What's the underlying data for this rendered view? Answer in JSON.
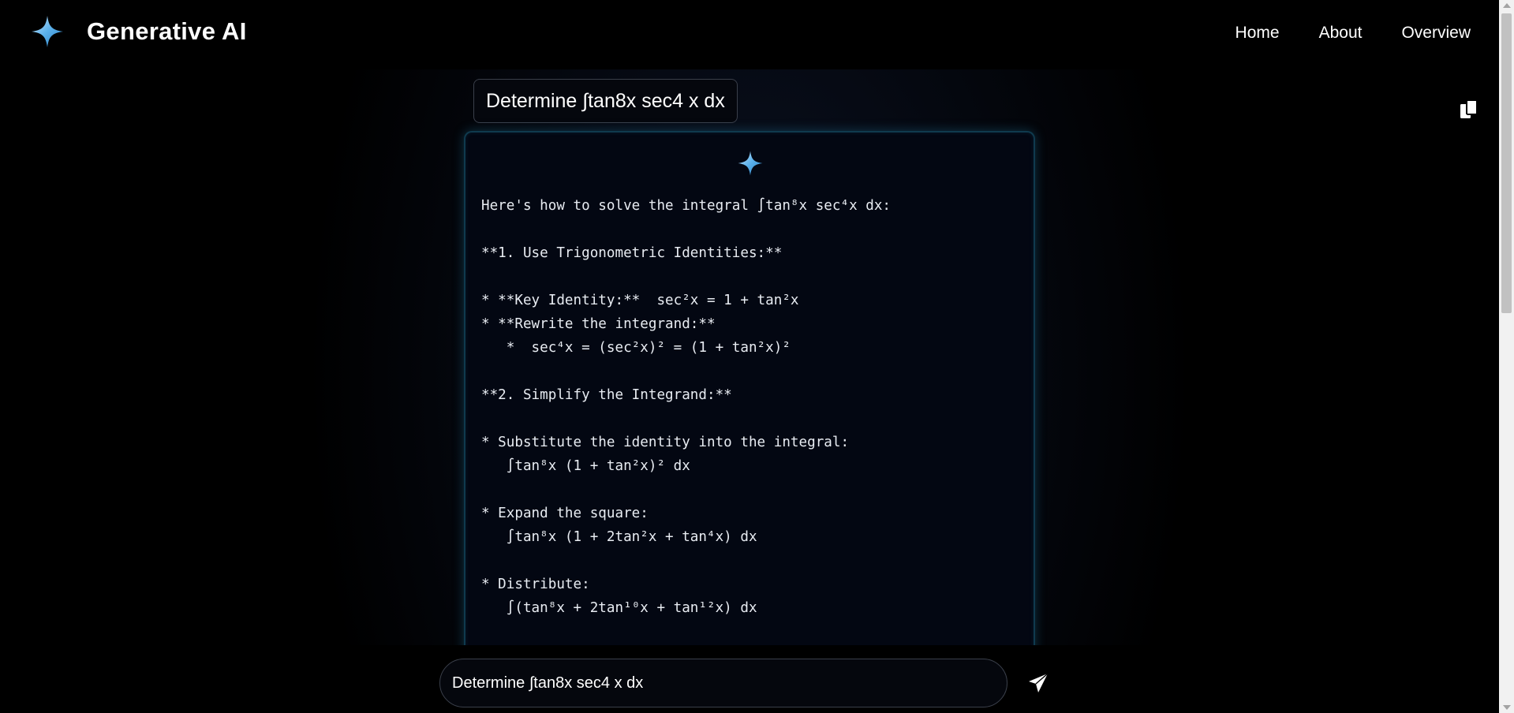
{
  "brand": {
    "title": "Generative AI",
    "icon": "sparkle-icon"
  },
  "nav": {
    "items": [
      {
        "label": "Home"
      },
      {
        "label": "About"
      },
      {
        "label": "Overview"
      }
    ]
  },
  "query": {
    "text": "Determine ∫tan8x sec4 x dx"
  },
  "copy": {
    "icon": "copy-icon"
  },
  "answer": {
    "icon": "sparkle-icon",
    "text": "Here's how to solve the integral ∫tan⁸x sec⁴x dx:\n\n**1. Use Trigonometric Identities:**\n\n* **Key Identity:**  sec²x = 1 + tan²x\n* **Rewrite the integrand:**\n   *  sec⁴x = (sec²x)² = (1 + tan²x)²\n\n**2. Simplify the Integrand:**\n\n* Substitute the identity into the integral:\n   ∫tan⁸x (1 + tan²x)² dx\n\n* Expand the square:\n   ∫tan⁸x (1 + 2tan²x + tan⁴x) dx\n\n* Distribute:\n   ∫(tan⁸x + 2tan¹⁰x + tan¹²x) dx"
  },
  "input": {
    "value": "Determine ∫tan8x sec4 x dx",
    "placeholder": ""
  },
  "send": {
    "icon": "send-icon"
  },
  "colors": {
    "background": "#000000",
    "accent": "#4aa3df",
    "card_border": "#0f3a4e"
  }
}
